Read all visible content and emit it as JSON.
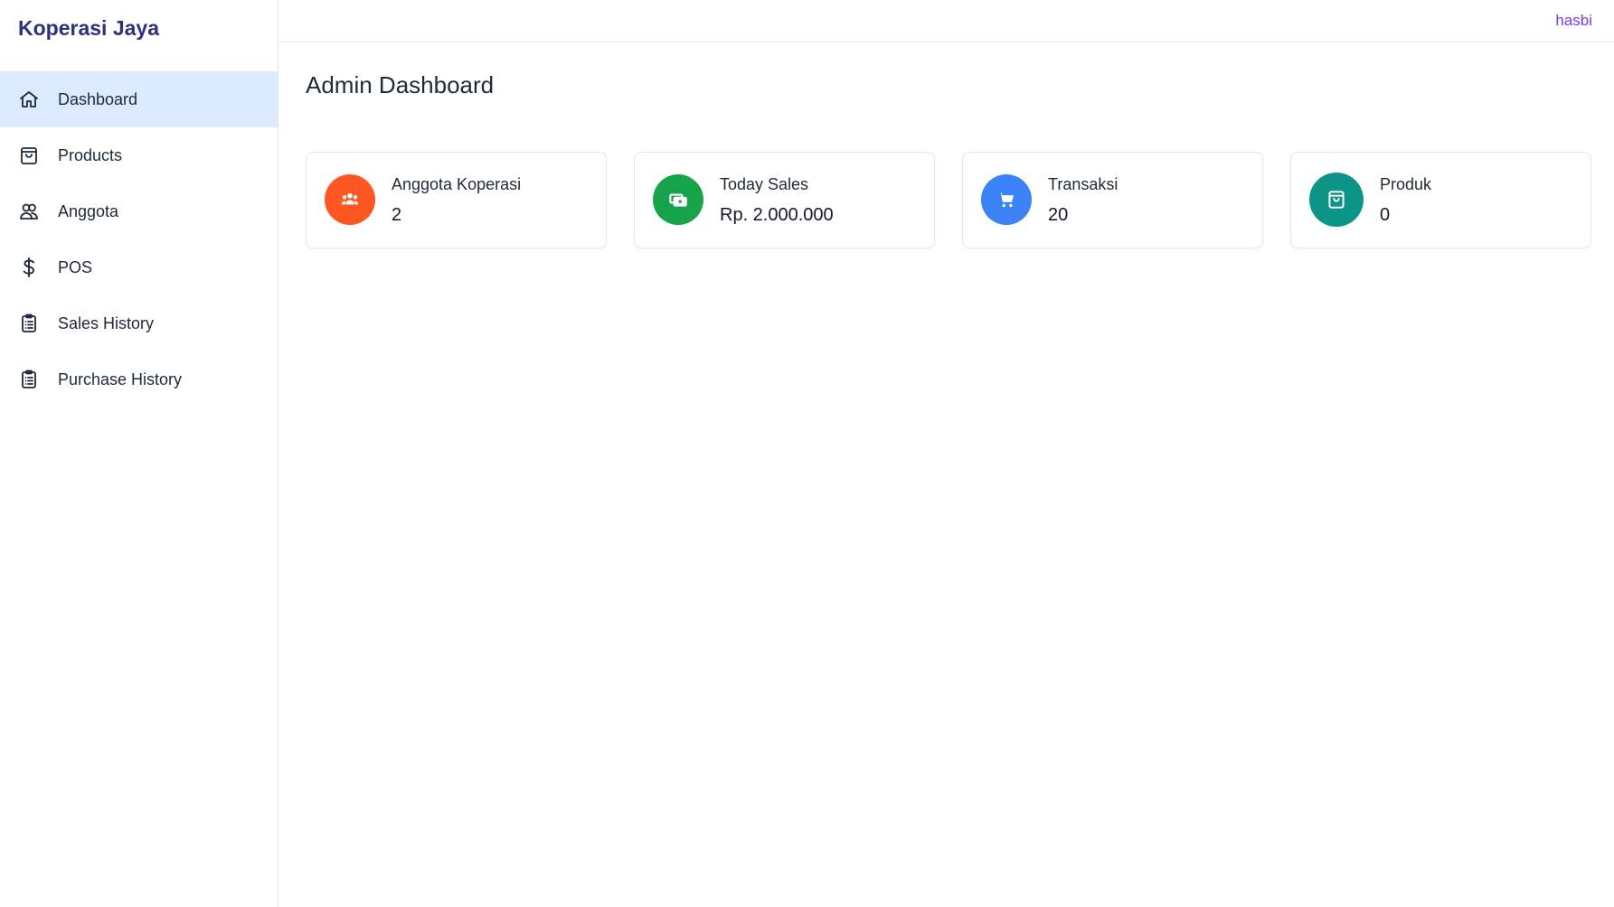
{
  "app": {
    "brand": "Koperasi Jaya",
    "user": "hasbi"
  },
  "sidebar": {
    "items": [
      {
        "label": "Dashboard",
        "icon": "home-icon",
        "active": true
      },
      {
        "label": "Products",
        "icon": "shopping-bag-icon",
        "active": false
      },
      {
        "label": "Anggota",
        "icon": "users-icon",
        "active": false
      },
      {
        "label": "POS",
        "icon": "dollar-icon",
        "active": false
      },
      {
        "label": "Sales History",
        "icon": "clipboard-list-icon",
        "active": false
      },
      {
        "label": "Purchase History",
        "icon": "clipboard-list-icon",
        "active": false
      }
    ]
  },
  "main": {
    "title": "Admin Dashboard",
    "cards": [
      {
        "label": "Anggota Koperasi",
        "value": "2",
        "icon": "user-group-icon",
        "color": "#ff5722"
      },
      {
        "label": "Today Sales",
        "value": "Rp. 2.000.000",
        "icon": "cash-icon",
        "color": "#16a34a"
      },
      {
        "label": "Transaksi",
        "value": "20",
        "icon": "cart-icon",
        "color": "#3b82f6"
      },
      {
        "label": "Produk",
        "value": "0",
        "icon": "shopping-bag-icon",
        "color": "#0d9488"
      }
    ]
  },
  "colors": {
    "active_nav_bg": "#dbeafe",
    "brand": "#312e81",
    "user_link": "#7c3aed"
  }
}
